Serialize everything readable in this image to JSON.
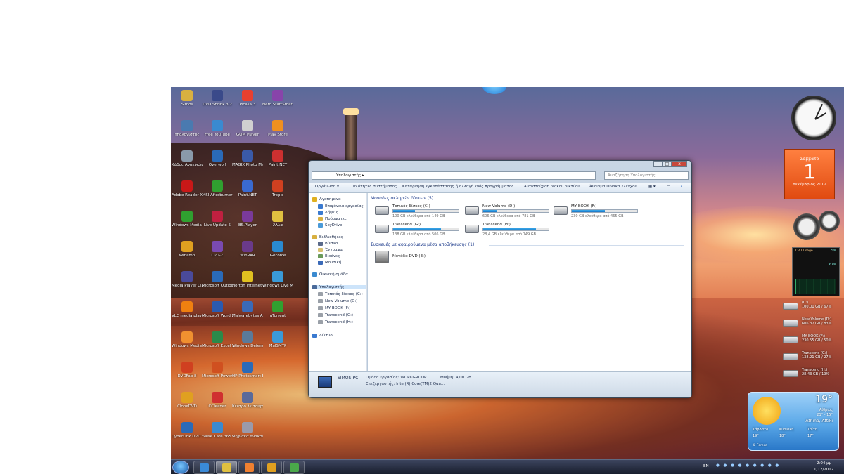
{
  "desktop": {
    "icons": [
      {
        "label": "Simos",
        "color": "#d8b040"
      },
      {
        "label": "DVD Shrink 3.2",
        "color": "#3a4a8a"
      },
      {
        "label": "Picasa 3",
        "color": "#e84030"
      },
      {
        "label": "Nero StartSmart",
        "color": "#8844aa"
      },
      {
        "label": "Υπολογιστής",
        "color": "#4a7ab0"
      },
      {
        "label": "Free YouTube",
        "color": "#3a8ad0"
      },
      {
        "label": "GOM Player",
        "color": "#d0d0d0"
      },
      {
        "label": "Play Store",
        "color": "#f09020"
      },
      {
        "label": "Κάδος Ανακύκλωσης",
        "color": "#8a9aaa"
      },
      {
        "label": "Overwolf",
        "color": "#2a6ab8"
      },
      {
        "label": "MAGIX Photo Manager",
        "color": "#3a5aa8"
      },
      {
        "label": "Paint.NET",
        "color": "#cc3030"
      },
      {
        "label": "Adobe Reader XI",
        "color": "#c81818"
      },
      {
        "label": "MSI Afterburner",
        "color": "#30a030"
      },
      {
        "label": "Paint.NET",
        "color": "#3a6ad0"
      },
      {
        "label": "Tropic",
        "color": "#d04020"
      },
      {
        "label": "Windows Media Center",
        "color": "#30a030"
      },
      {
        "label": "Live Update 5",
        "color": "#c02040"
      },
      {
        "label": "BS.Player",
        "color": "#7a3a9a"
      },
      {
        "label": "Άλλα",
        "color": "#e0c040"
      },
      {
        "label": "Winamp",
        "color": "#e0a020"
      },
      {
        "label": "CPU-Z",
        "color": "#7a4ab0"
      },
      {
        "label": "WinRAR",
        "color": "#6a3a8a"
      },
      {
        "label": "GeForce",
        "color": "#2a8ad0"
      },
      {
        "label": "Media Player Classic",
        "color": "#4a4a9a"
      },
      {
        "label": "Microsoft Outlook 2013",
        "color": "#2a6ab8"
      },
      {
        "label": "Norton Internet Security",
        "color": "#e0c020"
      },
      {
        "label": "Windows Live Messenger",
        "color": "#3a9ad8"
      },
      {
        "label": "VLC media player",
        "color": "#f08010"
      },
      {
        "label": "Microsoft Word 2013",
        "color": "#2a5ab0"
      },
      {
        "label": "Malwarebytes Anti-Malware",
        "color": "#3a6ab8"
      },
      {
        "label": "uTorrent",
        "color": "#30a030"
      },
      {
        "label": "Windows Media Player",
        "color": "#f09030"
      },
      {
        "label": "Microsoft Excel 2013",
        "color": "#2a8a4a"
      },
      {
        "label": "Windows Defender",
        "color": "#5a7a9a"
      },
      {
        "label": "MalSMTP",
        "color": "#3a9ad8"
      },
      {
        "label": "DVDFab 8",
        "color": "#d04020"
      },
      {
        "label": "Microsoft PowerPoint",
        "color": "#d05020"
      },
      {
        "label": "HP Photosmart Essential 3.5",
        "color": "#2a6ab8"
      },
      {
        "label": "",
        "color": "rgba(0,0,0,0)"
      },
      {
        "label": "CloneDVD",
        "color": "#e0a020"
      },
      {
        "label": "CCleaner",
        "color": "#d03030"
      },
      {
        "label": "Κέντρο λειτουργιών",
        "color": "#5a6a9a"
      },
      {
        "label": "",
        "color": "rgba(0,0,0,0)"
      },
      {
        "label": "CyberLink DVD Suite",
        "color": "#2a6ab8"
      },
      {
        "label": "Wise Care 365",
        "color": "#3a8ad0"
      },
      {
        "label": "Ψηφιακά ανακοίνωσ",
        "color": "#9a9aaa"
      },
      {
        "label": "",
        "color": "rgba(0,0,0,0)"
      }
    ]
  },
  "explorer": {
    "window_buttons": {
      "minimize": "—",
      "maximize": "□",
      "close": "x"
    },
    "address": "Υπολογιστής ▸",
    "search_placeholder": "Αναζήτηση Υπολογιστής",
    "toolbar": {
      "organize": "Οργάνωση ▾",
      "system_properties": "Ιδιότητες συστήματος",
      "uninstall": "Κατάργηση εγκατάστασης ή αλλαγή ενός προγράμματος",
      "map_drive": "Αντιστοίχιση δίσκου δικτύου",
      "control_panel": "Άνοιγμα Πίνακα ελέγχου"
    },
    "nav": {
      "favorites": "Αγαπημένα",
      "fav_items": [
        "Επιφάνεια εργασίας",
        "Λήψεις",
        "Πρόσφατες",
        "SkyDrive"
      ],
      "libraries": "Βιβλιοθήκες",
      "lib_items": [
        "Βίντεο",
        "Έγγραφα",
        "Εικόνες",
        "Μουσική"
      ],
      "homegroup": "Οικιακή ομάδα",
      "computer": "Υπολογιστής",
      "comp_items": [
        "Τοπικός δίσκος (C:)",
        "New Volume (D:)",
        "MY BOOK (F:)",
        "Transcend (G:)",
        "Transcend (H:)"
      ],
      "network": "Δίκτυο"
    },
    "hdd_group": "Μονάδες σκληρών δίσκων (5)",
    "drives": [
      {
        "name": "Τοπικός δίσκος (C:)",
        "free": "100 GB ελεύθερα από 149 GB",
        "used": 0.33
      },
      {
        "name": "New Volume (D:)",
        "free": "606 GB ελεύθερα από 781 GB",
        "used": 0.22
      },
      {
        "name": "MY BOOK (F:)",
        "free": "230 GB ελεύθερα από 465 GB",
        "used": 0.5
      },
      {
        "name": "Transcend (G:)",
        "free": "138 GB ελεύθερα από 506 GB",
        "used": 0.73
      },
      {
        "name": "Transcend (H:)",
        "free": "28,4 GB ελεύθερα από 149 GB",
        "used": 0.81
      }
    ],
    "removable_group": "Συσκευές με αφαιρούμενα μέσα αποθήκευσης (1)",
    "dvd": "Μονάδα DVD (E:)",
    "details": {
      "pc": "SIMOS-PC",
      "workgroup": "Ομάδα εργασίας: WORKGROUP",
      "memory": "Μνήμη: 4,00 GB",
      "processor": "Επεξεργαστής: Intel(R) Core(TM)2 Qua..."
    }
  },
  "gadgets": {
    "calendar": {
      "weekday": "Σάββατο",
      "day": "1",
      "month": "Δεκέμβριος 2012"
    },
    "cpu": {
      "title": "CPU Usage",
      "percent": "5%",
      "ram": "67%"
    },
    "drives": [
      {
        "label": "(C:)",
        "info": "100.01 GB / 67%"
      },
      {
        "label": "New Volume (D:)",
        "info": "606.37 GB / 83%"
      },
      {
        "label": "MY BOOK (F:)",
        "info": "230.55 GB / 50%"
      },
      {
        "label": "Transcend (G:)",
        "info": "138.21 GB / 27%"
      },
      {
        "label": "Transcend (H:)",
        "info": "28.43 GB / 19%"
      }
    ],
    "weather": {
      "temp": "19°",
      "condition": "Αίθριος",
      "range": "21° - 15°",
      "location": "Athina, Attiki",
      "d1": "Σάββατο",
      "d2": "Κυριακή",
      "d3": "Τρίτη",
      "t1": "19°",
      "t2": "18°",
      "t3": "17°",
      "source": "© Foreca"
    }
  },
  "taskbar": {
    "lang": "EN",
    "time": "2:04 μμ",
    "date": "1/12/2012"
  }
}
